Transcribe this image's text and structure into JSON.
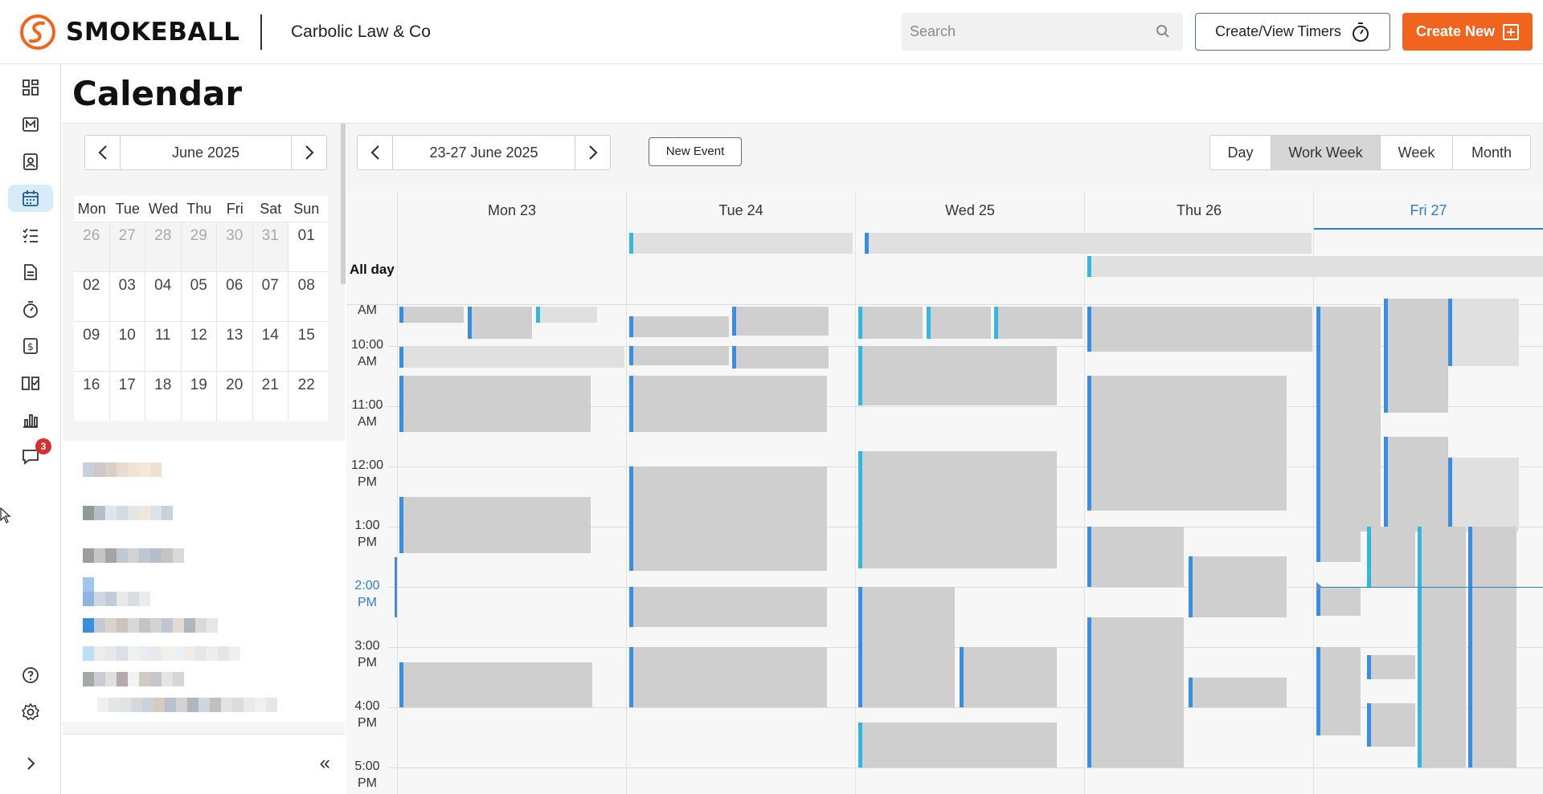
{
  "header": {
    "brand": "SMOKEBALL",
    "firm_name": "Carbolic Law & Co",
    "search_placeholder": "Search",
    "timers_label": "Create/View Timers",
    "create_label": "Create New",
    "brand_color": "#f0641e"
  },
  "nav": {
    "items": [
      "dashboard-icon",
      "matters-icon",
      "contacts-icon",
      "calendar-icon",
      "tasks-icon",
      "documents-icon",
      "timers-icon",
      "billing-icon",
      "intake-icon",
      "reports-icon",
      "messages-icon",
      "help-icon",
      "settings-icon",
      "expand-icon"
    ],
    "messages_badge": "3",
    "active": "calendar-icon"
  },
  "page": {
    "title": "Calendar"
  },
  "mini_calendar": {
    "month_label": "June 2025",
    "weekdays": [
      "Mon",
      "Tue",
      "Wed",
      "Thu",
      "Fri",
      "Sat",
      "Sun"
    ],
    "weeks": [
      [
        "26",
        "27",
        "28",
        "29",
        "30",
        "31",
        "01"
      ],
      [
        "02",
        "03",
        "04",
        "05",
        "06",
        "07",
        "08"
      ],
      [
        "09",
        "10",
        "11",
        "12",
        "13",
        "14",
        "15"
      ],
      [
        "16",
        "17",
        "18",
        "19",
        "20",
        "21",
        "22"
      ]
    ]
  },
  "calendar": {
    "range_label": "23-27 June 2025",
    "new_event_label": "New Event",
    "views": [
      "Day",
      "Work Week",
      "Week",
      "Month"
    ],
    "active_view": "Work Week",
    "days": [
      "Mon 23",
      "Tue 24",
      "Wed 25",
      "Thu 26",
      "Fri 27"
    ],
    "today": "Fri 27",
    "allday_label": "All day",
    "times": [
      [
        "10:00",
        "AM"
      ],
      [
        "11:00",
        "AM"
      ],
      [
        "12:00",
        "PM"
      ],
      [
        "1:00",
        "PM"
      ],
      [
        "2:00",
        "PM"
      ],
      [
        "3:00",
        "PM"
      ],
      [
        "4:00",
        "PM"
      ],
      [
        "5:00",
        "PM"
      ]
    ],
    "current_time_label": "2:00 PM",
    "top_partial_label": "AM"
  }
}
